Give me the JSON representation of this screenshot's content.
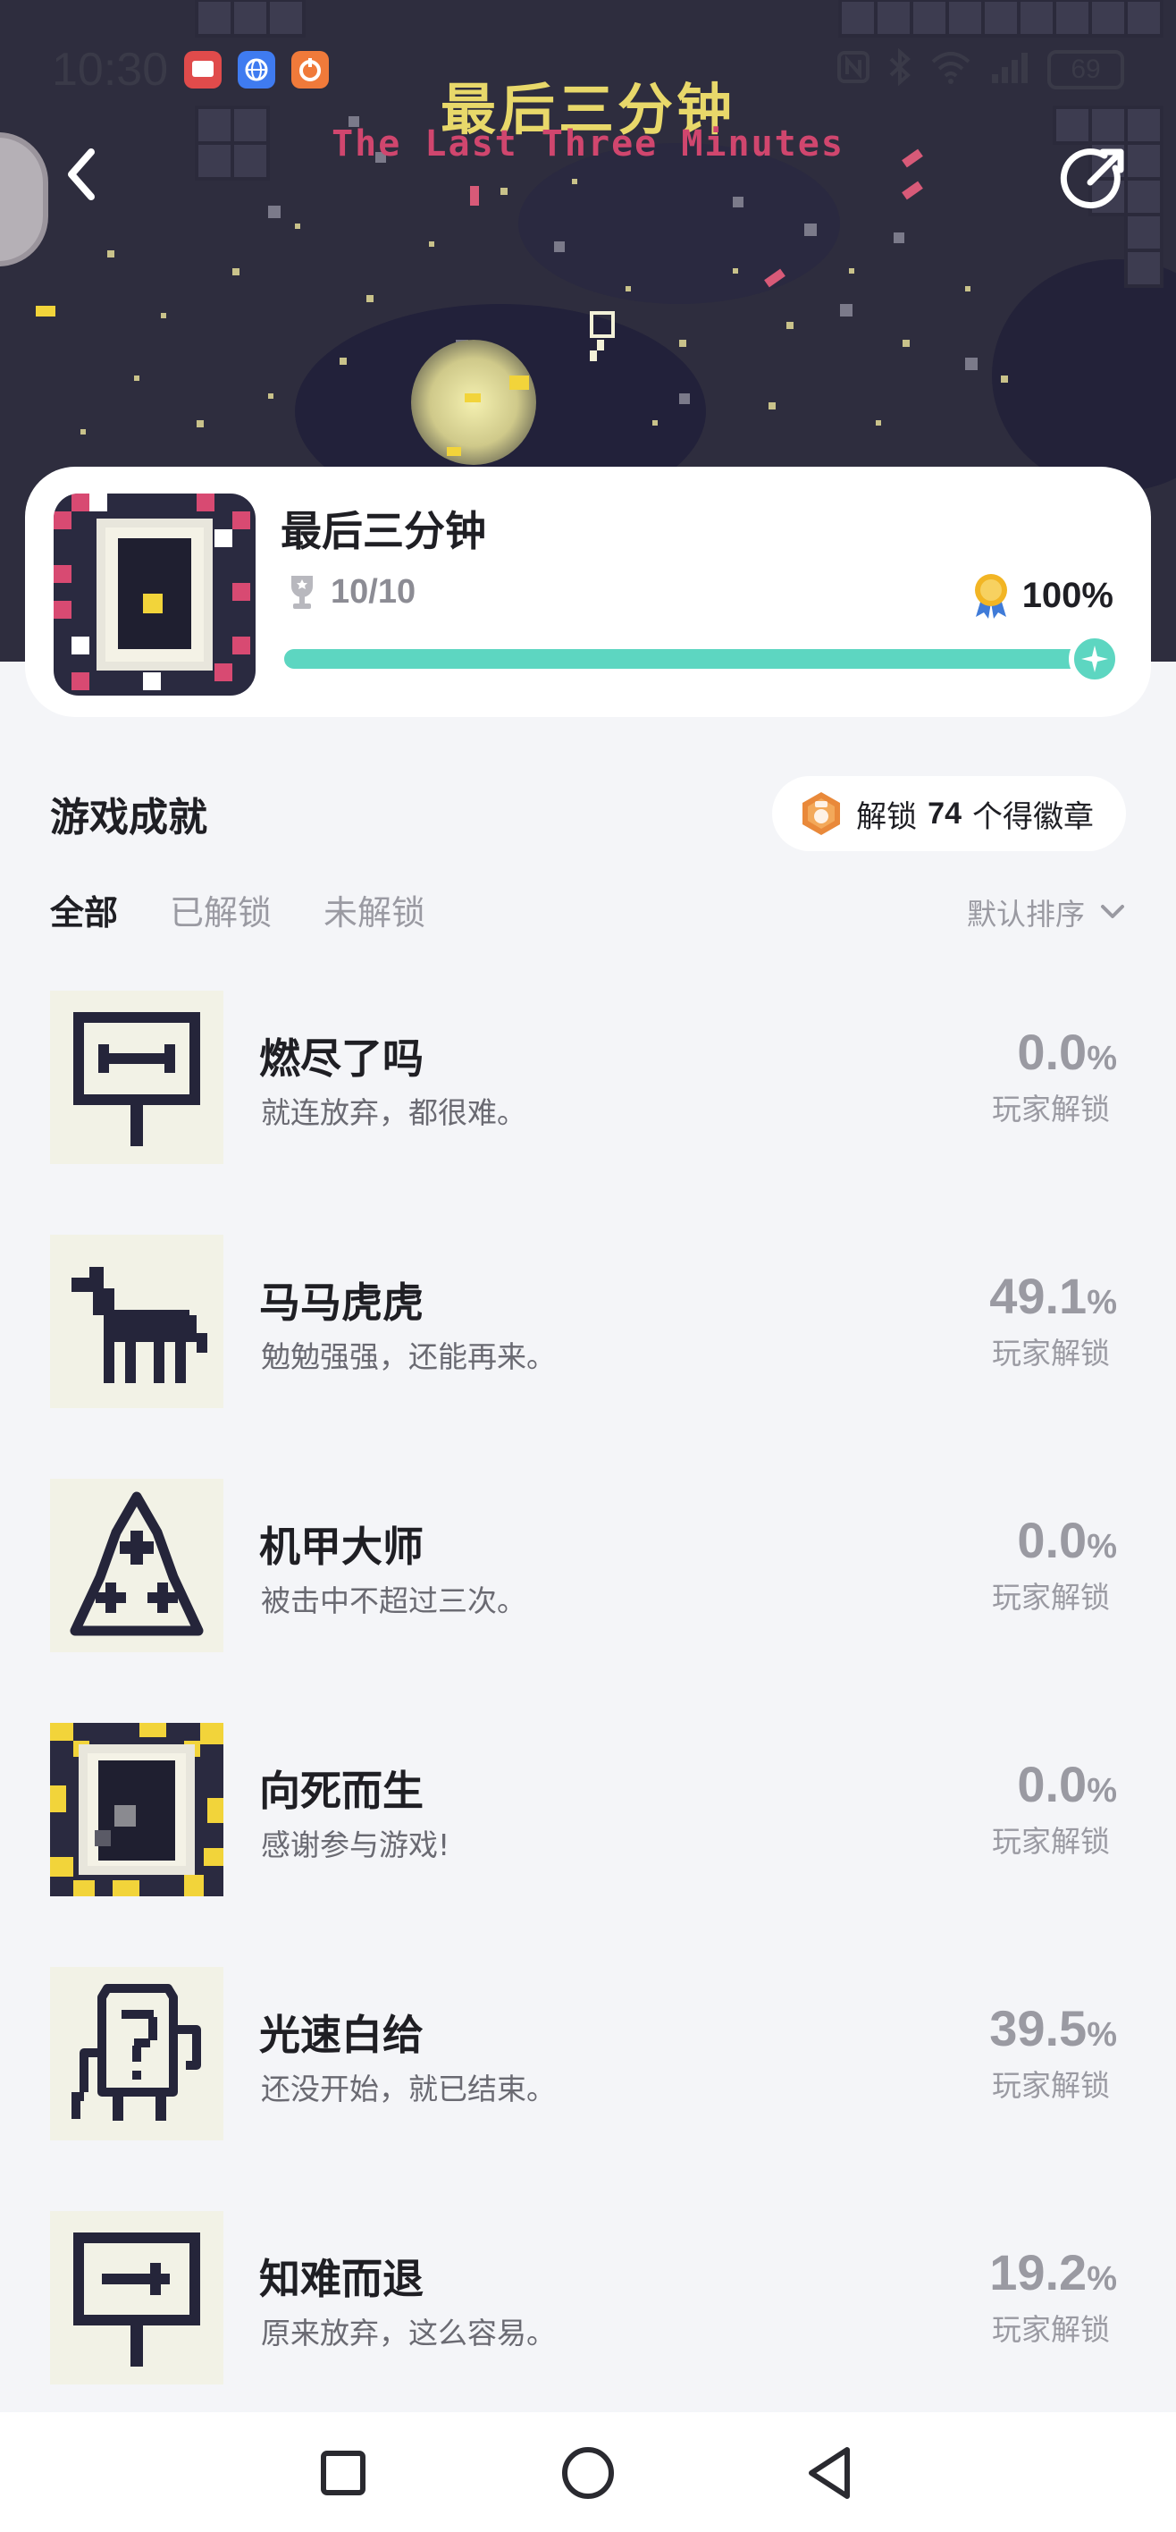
{
  "status_bar": {
    "time": "10:30",
    "battery": "69",
    "notification_icons": [
      "red-app-icon",
      "blue-globe-icon",
      "orange-app-icon"
    ],
    "indicator_icons": [
      "nfc-icon",
      "bluetooth-icon",
      "wifi-icon",
      "signal-icon"
    ]
  },
  "banner": {
    "title_cn": "最后三分钟",
    "title_en": "The Last Three Minutes"
  },
  "game": {
    "title": "最后三分钟",
    "trophy_count": "10/10",
    "completion": "100%",
    "progress": 1.0
  },
  "achievements_header": {
    "title": "游戏成就",
    "badge_prefix": "解锁",
    "badge_count": "74",
    "badge_suffix": "个得徽章"
  },
  "tabs": [
    {
      "label": "全部",
      "active": true
    },
    {
      "label": "已解锁",
      "active": false
    },
    {
      "label": "未解锁",
      "active": false
    }
  ],
  "sort": {
    "label": "默认排序"
  },
  "achievements": [
    {
      "name": "燃尽了吗",
      "desc": "就连放弃，都很难。",
      "pct": "0.0",
      "unit": "%",
      "label": "玩家解锁",
      "icon": "sign-minus-icon"
    },
    {
      "name": "马马虎虎",
      "desc": "勉勉强强，还能再来。",
      "pct": "49.1",
      "unit": "%",
      "label": "玩家解锁",
      "icon": "horse-icon"
    },
    {
      "name": "机甲大师",
      "desc": "被击中不超过三次。",
      "pct": "0.0",
      "unit": "%",
      "label": "玩家解锁",
      "icon": "triangle-crosses-icon"
    },
    {
      "name": "向死而生",
      "desc": "感谢参与游戏!",
      "pct": "0.0",
      "unit": "%",
      "label": "玩家解锁",
      "icon": "doorway-icon"
    },
    {
      "name": "光速白给",
      "desc": "还没开始，就已结束。",
      "pct": "39.5",
      "unit": "%",
      "label": "玩家解锁",
      "icon": "question-robot-icon"
    },
    {
      "name": "知难而退",
      "desc": "原来放弃，这么容易。",
      "pct": "19.2",
      "unit": "%",
      "label": "玩家解锁",
      "icon": "sign-arrow-icon"
    }
  ],
  "colors": {
    "accent": "#5dd6c1",
    "page_bg": "#f4f5f8",
    "hero_bg": "#2e2d3e",
    "banner_yellow": "#e8d86a",
    "banner_red": "#d0466e",
    "pixel_dark": "#25253a"
  }
}
